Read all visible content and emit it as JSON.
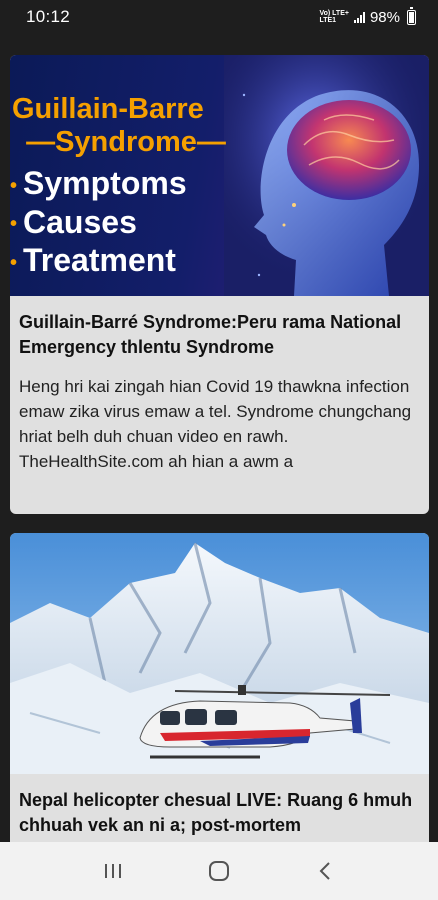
{
  "status_bar": {
    "time": "10:12",
    "network_top": "Vo) LTE+",
    "network_bottom": "LTE1",
    "battery": "98%"
  },
  "articles": [
    {
      "image": {
        "title_line1": "Guillain-Barre",
        "title_line2": "—Syndrome—",
        "bullets": [
          "Symptoms",
          "Causes",
          "Treatment"
        ],
        "colors": {
          "accent": "#f5a000",
          "background": "#131e6a"
        }
      },
      "title": "Guillain-Barré Syndrome:Peru rama National Emergency thlentu Syndrome",
      "description": "Heng hri kai zingah hian Covid 19 thawkna infection emaw zika virus emaw a tel. Syndrome chungchang hriat belh duh chuan video en rawh. TheHealthSite.com ah hian a awm a"
    },
    {
      "image": {
        "subject": "snowy-mountain-helicopter"
      },
      "title": "Nepal helicopter chesual LIVE: Ruang 6 hmuh chhuah vek an ni a; post-mortem"
    }
  ],
  "nav_bar": {
    "recents_icon": "recents-icon",
    "home_icon": "home-icon",
    "back_icon": "back-icon"
  }
}
